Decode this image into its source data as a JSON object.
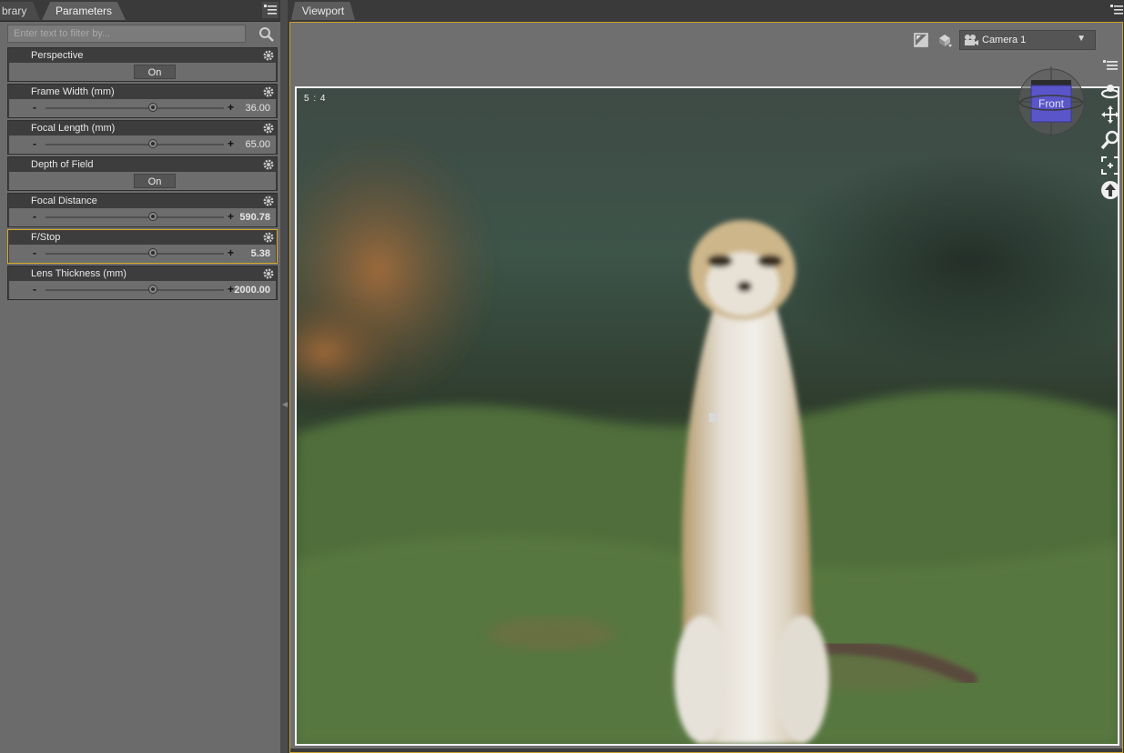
{
  "left_pane": {
    "tabs": [
      {
        "label": "brary"
      },
      {
        "label": "Parameters"
      }
    ],
    "filter": {
      "placeholder": "Enter text to filter by..."
    },
    "params": [
      {
        "name": "Perspective",
        "kind": "toggle",
        "value": "On"
      },
      {
        "name": "Frame Width (mm)",
        "kind": "slider",
        "value": "36.00",
        "bold": false,
        "position": 0.45
      },
      {
        "name": "Focal Length (mm)",
        "kind": "slider",
        "value": "65.00",
        "bold": false,
        "position": 0.45
      },
      {
        "name": "Depth of Field",
        "kind": "toggle",
        "value": "On"
      },
      {
        "name": "Focal Distance",
        "kind": "slider",
        "value": "590.78",
        "bold": true,
        "position": 0.45
      },
      {
        "name": "F/Stop",
        "kind": "slider",
        "value": "5.38",
        "bold": true,
        "position": 0.45,
        "selected": true
      },
      {
        "name": "Lens Thickness (mm)",
        "kind": "slider",
        "value": "2000.00",
        "bold": true,
        "position": 0.45
      }
    ]
  },
  "viewport": {
    "tab_label": "Viewport",
    "camera": "Camera 1",
    "aspect_ratio": "5 : 4",
    "nav_cube_label": "Front"
  },
  "colors": {
    "panel_bg": "#6b6b6b",
    "param_header": "#3d3d3d",
    "selection_accent": "#d4a829",
    "viewport_border": "#c6a032",
    "nav_cube_face": "#5a55c8"
  },
  "icons": [
    "pane-menu-icon",
    "search-icon",
    "gear-icon",
    "render-settings-icon",
    "draw-style-icon",
    "camera-icon",
    "dropdown-arrow-icon",
    "orbit-icon",
    "pan-icon",
    "zoom-icon",
    "frame-icon",
    "reset-view-icon"
  ]
}
